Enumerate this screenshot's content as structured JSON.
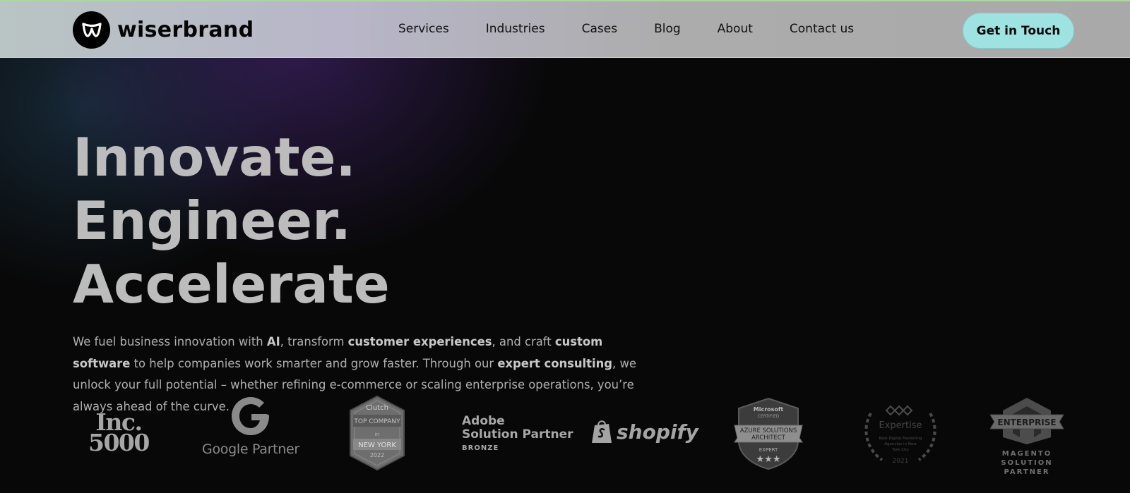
{
  "brand": {
    "name": "wiserbrand",
    "logo_icon": "wiserbrand-w-icon"
  },
  "nav": {
    "items": [
      {
        "label": "Services"
      },
      {
        "label": "Industries"
      },
      {
        "label": "Cases"
      },
      {
        "label": "Blog"
      },
      {
        "label": "About"
      },
      {
        "label": "Contact us"
      }
    ],
    "cta_label": "Get in Touch"
  },
  "hero": {
    "heading_line1": "Innovate. Engineer.",
    "heading_line2": "Accelerate",
    "paragraph": {
      "t1": "We fuel business innovation with ",
      "b1": "AI",
      "t2": ", transform ",
      "b2": "customer experiences",
      "t3": ", and craft ",
      "b3": "custom software",
      "t4": " to help companies work smarter and grow faster. Through our ",
      "b4": "expert consulting",
      "t5": ", we unlock your full potential – whether refining e-commerce or scaling enterprise operations, you’re always ahead of the curve."
    }
  },
  "partners": {
    "inc": {
      "line1": "Inc.",
      "line2": "5000"
    },
    "google": {
      "label": "Google Partner"
    },
    "clutch": {
      "brand": "Clutch",
      "line1": "TOP COMPANY",
      "line2": "in",
      "line3": "NEW YORK",
      "year": "2022"
    },
    "adobe": {
      "line1": "Adobe",
      "line2": "Solution Partner",
      "tier": "BRONZE"
    },
    "shopify": {
      "label": "shopify"
    },
    "azure": {
      "brand": "Microsoft",
      "certified": "CERTIFIED",
      "line1": "AZURE SOLUTIONS",
      "line2": "ARCHITECT",
      "level": "EXPERT"
    },
    "expertise": {
      "brand": "Expertise",
      "line1": "Best Digital Marketing",
      "line2": "Agencies in New",
      "line3": "York City",
      "year": "2021"
    },
    "magento": {
      "ribbon": "ENTERPRISE",
      "line1": "MAGENTO",
      "line2": "SOLUTION",
      "line3": "PARTNER"
    }
  },
  "colors": {
    "background": "#080808",
    "nav_background": "#b0b0b4",
    "cta_background": "#9ee3e1",
    "heading_text": "#bcbcbc",
    "top_accent_line": "#a8d8a0"
  }
}
